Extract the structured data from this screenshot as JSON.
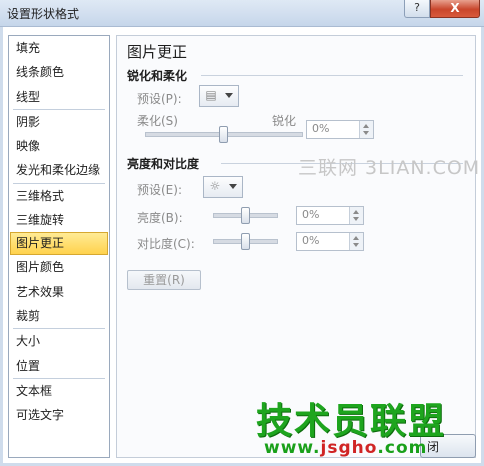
{
  "window": {
    "title": "设置形状格式",
    "help_label": "?",
    "close_label": "X"
  },
  "sidebar": {
    "items": [
      {
        "label": "填充"
      },
      {
        "label": "线条颜色"
      },
      {
        "label": "线型"
      },
      {
        "label": "阴影"
      },
      {
        "label": "映像"
      },
      {
        "label": "发光和柔化边缘"
      },
      {
        "label": "三维格式"
      },
      {
        "label": "三维旋转"
      },
      {
        "label": "图片更正",
        "selected": true
      },
      {
        "label": "图片颜色"
      },
      {
        "label": "艺术效果"
      },
      {
        "label": "裁剪"
      },
      {
        "label": "大小"
      },
      {
        "label": "位置"
      },
      {
        "label": "文本框"
      },
      {
        "label": "可选文字"
      }
    ]
  },
  "panel": {
    "title": "图片更正",
    "sharpen": {
      "section_title": "锐化和柔化",
      "preset_label": "预设(P):",
      "preset_icon": "sharpen-preset-icon",
      "soften_label": "柔化(S)",
      "sharpen_label": "锐化",
      "slider_value": 0.5,
      "value": "0%"
    },
    "brightness": {
      "section_title": "亮度和对比度",
      "preset_label": "预设(E):",
      "preset_icon": "brightness-preset-icon",
      "brightness_label": "亮度(B):",
      "brightness_slider_value": 0.5,
      "brightness_value": "0%",
      "contrast_label": "对比度(C):",
      "contrast_slider_value": 0.5,
      "contrast_value": "0%"
    },
    "reset_label": "重置(R)"
  },
  "watermarks": {
    "top": "三联网 3LIAN.COM",
    "brand": "技术员联盟",
    "url_prefix": "www.",
    "url_mid": "jsgho",
    "url_suffix": ".com"
  },
  "footer": {
    "close_partial": "闭"
  }
}
